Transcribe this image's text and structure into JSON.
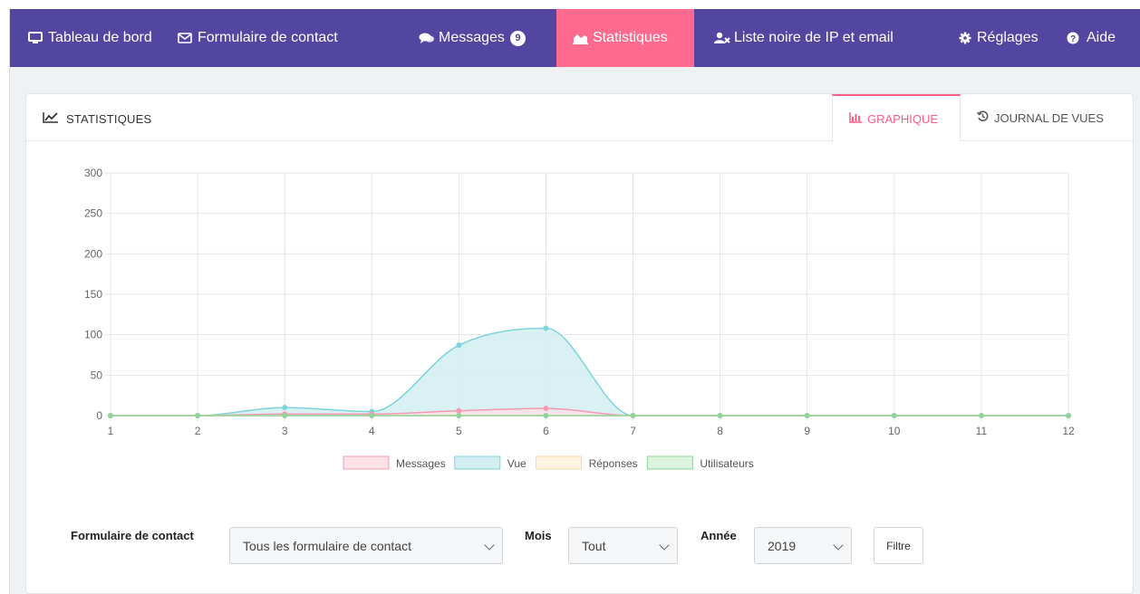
{
  "nav": {
    "items": [
      {
        "label": "Tableau de bord",
        "icon": "monitor-icon"
      },
      {
        "label": "Formulaire de contact",
        "icon": "envelope-icon"
      },
      {
        "label": "Messages",
        "icon": "comments-icon",
        "badge": "9"
      },
      {
        "label": "Statistiques",
        "icon": "area-chart-icon",
        "active": true
      },
      {
        "label": "Liste noire de IP et email",
        "icon": "user-block-icon"
      },
      {
        "label": "Réglages",
        "icon": "gear-icon"
      },
      {
        "label": "Aide",
        "icon": "question-circle-icon"
      }
    ],
    "colors": {
      "bar": "#5346a0",
      "active": "#ff6a8e"
    }
  },
  "panel": {
    "title": "STATISTIQUES",
    "tabs": [
      {
        "label": "GRAPHIQUE",
        "icon": "bar-chart-icon",
        "active": true
      },
      {
        "label": "JOURNAL DE VUES",
        "icon": "history-icon"
      }
    ]
  },
  "chart_data": {
    "type": "area",
    "x": [
      1,
      2,
      3,
      4,
      5,
      6,
      7,
      8,
      9,
      10,
      11,
      12
    ],
    "ylim": [
      0,
      300
    ],
    "yticks": [
      0,
      50,
      100,
      150,
      200,
      250,
      300
    ],
    "grid": true,
    "legend_position": "bottom",
    "series": [
      {
        "name": "Messages",
        "values": [
          0,
          0,
          2,
          2,
          6,
          9,
          0,
          0,
          0,
          0,
          0,
          0
        ],
        "color": "#f29bb0",
        "fill": "#fde2e8"
      },
      {
        "name": "Vue",
        "values": [
          0,
          0,
          10,
          5,
          87,
          108,
          0,
          0,
          0,
          0,
          0,
          0
        ],
        "color": "#7fd3dc",
        "fill": "#d4eff2"
      },
      {
        "name": "Réponses",
        "values": [
          0,
          0,
          0,
          0,
          0,
          0,
          0,
          0,
          0,
          0,
          0,
          0
        ],
        "color": "#fbd7a6",
        "fill": "#fff3e2"
      },
      {
        "name": "Utilisateurs",
        "values": [
          0,
          0,
          0,
          0,
          0,
          0,
          0,
          0,
          0,
          0,
          0,
          0
        ],
        "color": "#8fd49b",
        "fill": "#dcf3df"
      }
    ]
  },
  "filters": {
    "form_label": "Formulaire de contact",
    "form_value": "Tous les formulaire de contact",
    "month_label": "Mois",
    "month_value": "Tout",
    "year_label": "Année",
    "year_value": "2019",
    "filter_button": "Filtre"
  }
}
